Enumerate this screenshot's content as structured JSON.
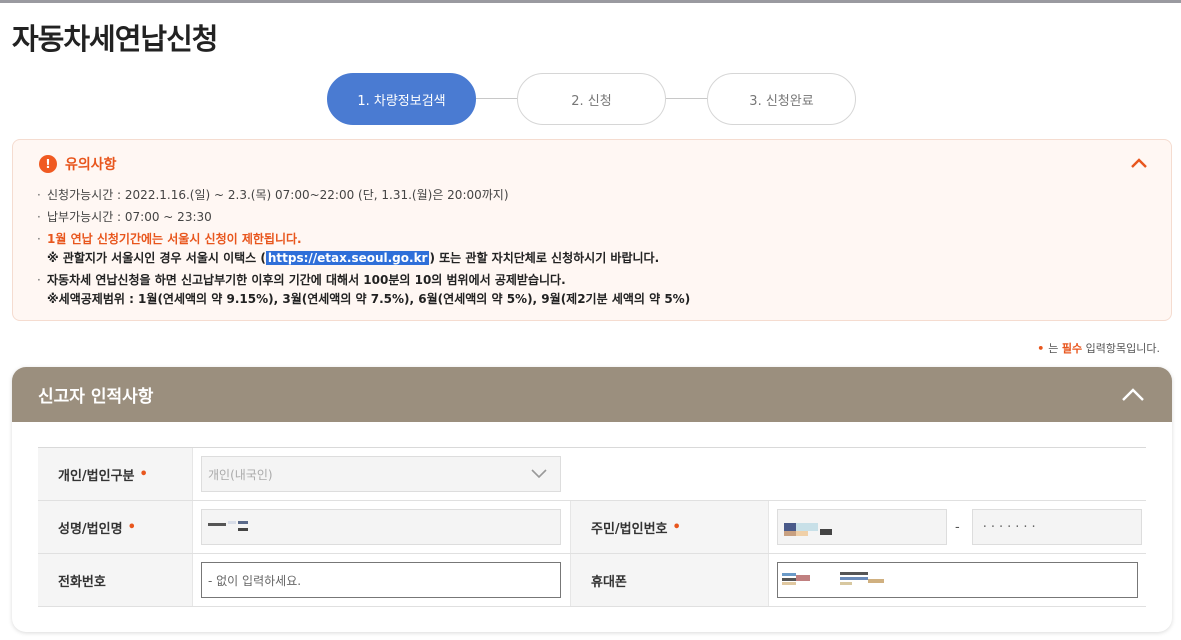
{
  "page": {
    "title": "자동차세연납신청"
  },
  "steps": [
    {
      "label": "1. 차량정보검색",
      "active": true
    },
    {
      "label": "2. 신청",
      "active": false
    },
    {
      "label": "3. 신청완료",
      "active": false
    }
  ],
  "notice": {
    "icon": "alert-icon",
    "title": "유의사항",
    "lines": {
      "apply_period": "신청가능시간 : 2022.1.16.(일) ~ 2.3.(목) 07:00~22:00 (단, 1.31.(월)은 20:00까지)",
      "pay_period": "납부가능시간 : 07:00 ~ 23:30",
      "jan_restrict": "1월 연납 신청기간에는 서울시 신청이 제한됩니다.",
      "jan_sub_pre": "※ 관할지가 서울시인 경우 서울시 이택스 (",
      "jan_sub_url": "https://etax.seoul.go.kr",
      "jan_sub_post": ") 또는 관할 자치단체로 신청하시기 바랍니다.",
      "deduct": "자동차세 연납신청을 하면 신고납부기한 이후의 기간에 대해서 100분의 10의 범위에서 공제받습니다.",
      "deduct_sub": "※세액공제범위 : 1월(연세액의 약 9.15%), 3월(연세액의 약 7.5%), 6월(연세액의 약 5%), 9월(제2기분 세액의 약 5%)"
    }
  },
  "required_note": {
    "dot": "•",
    "pre": "는",
    "req": "필수",
    "post": "입력항목입니다."
  },
  "section": {
    "title": "신고자 인적사항",
    "fields": {
      "type_label": "개인/법인구분",
      "type_value": "개인(내국인)",
      "name_label": "성명/법인명",
      "ssn_label": "주민/법인번호",
      "ssn_dash": "-",
      "ssn_masked": "·······",
      "tel_label": "전화번호",
      "tel_placeholder": "- 없이 입력하세요.",
      "mobile_label": "휴대폰",
      "required_dot": "•"
    }
  },
  "colors": {
    "accent_blue": "#4a7bd2",
    "required_orange": "#e8561d",
    "section_header": "#9b8f7e"
  }
}
